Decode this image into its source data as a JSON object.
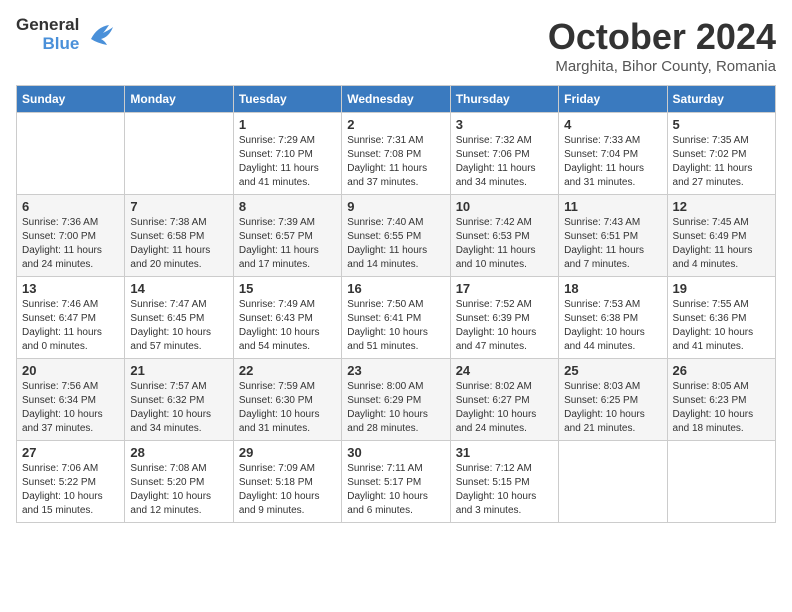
{
  "header": {
    "logo_general": "General",
    "logo_blue": "Blue",
    "month": "October 2024",
    "location": "Marghita, Bihor County, Romania"
  },
  "weekdays": [
    "Sunday",
    "Monday",
    "Tuesday",
    "Wednesday",
    "Thursday",
    "Friday",
    "Saturday"
  ],
  "weeks": [
    [
      {
        "day": "",
        "info": ""
      },
      {
        "day": "",
        "info": ""
      },
      {
        "day": "1",
        "info": "Sunrise: 7:29 AM\nSunset: 7:10 PM\nDaylight: 11 hours and 41 minutes."
      },
      {
        "day": "2",
        "info": "Sunrise: 7:31 AM\nSunset: 7:08 PM\nDaylight: 11 hours and 37 minutes."
      },
      {
        "day": "3",
        "info": "Sunrise: 7:32 AM\nSunset: 7:06 PM\nDaylight: 11 hours and 34 minutes."
      },
      {
        "day": "4",
        "info": "Sunrise: 7:33 AM\nSunset: 7:04 PM\nDaylight: 11 hours and 31 minutes."
      },
      {
        "day": "5",
        "info": "Sunrise: 7:35 AM\nSunset: 7:02 PM\nDaylight: 11 hours and 27 minutes."
      }
    ],
    [
      {
        "day": "6",
        "info": "Sunrise: 7:36 AM\nSunset: 7:00 PM\nDaylight: 11 hours and 24 minutes."
      },
      {
        "day": "7",
        "info": "Sunrise: 7:38 AM\nSunset: 6:58 PM\nDaylight: 11 hours and 20 minutes."
      },
      {
        "day": "8",
        "info": "Sunrise: 7:39 AM\nSunset: 6:57 PM\nDaylight: 11 hours and 17 minutes."
      },
      {
        "day": "9",
        "info": "Sunrise: 7:40 AM\nSunset: 6:55 PM\nDaylight: 11 hours and 14 minutes."
      },
      {
        "day": "10",
        "info": "Sunrise: 7:42 AM\nSunset: 6:53 PM\nDaylight: 11 hours and 10 minutes."
      },
      {
        "day": "11",
        "info": "Sunrise: 7:43 AM\nSunset: 6:51 PM\nDaylight: 11 hours and 7 minutes."
      },
      {
        "day": "12",
        "info": "Sunrise: 7:45 AM\nSunset: 6:49 PM\nDaylight: 11 hours and 4 minutes."
      }
    ],
    [
      {
        "day": "13",
        "info": "Sunrise: 7:46 AM\nSunset: 6:47 PM\nDaylight: 11 hours and 0 minutes."
      },
      {
        "day": "14",
        "info": "Sunrise: 7:47 AM\nSunset: 6:45 PM\nDaylight: 10 hours and 57 minutes."
      },
      {
        "day": "15",
        "info": "Sunrise: 7:49 AM\nSunset: 6:43 PM\nDaylight: 10 hours and 54 minutes."
      },
      {
        "day": "16",
        "info": "Sunrise: 7:50 AM\nSunset: 6:41 PM\nDaylight: 10 hours and 51 minutes."
      },
      {
        "day": "17",
        "info": "Sunrise: 7:52 AM\nSunset: 6:39 PM\nDaylight: 10 hours and 47 minutes."
      },
      {
        "day": "18",
        "info": "Sunrise: 7:53 AM\nSunset: 6:38 PM\nDaylight: 10 hours and 44 minutes."
      },
      {
        "day": "19",
        "info": "Sunrise: 7:55 AM\nSunset: 6:36 PM\nDaylight: 10 hours and 41 minutes."
      }
    ],
    [
      {
        "day": "20",
        "info": "Sunrise: 7:56 AM\nSunset: 6:34 PM\nDaylight: 10 hours and 37 minutes."
      },
      {
        "day": "21",
        "info": "Sunrise: 7:57 AM\nSunset: 6:32 PM\nDaylight: 10 hours and 34 minutes."
      },
      {
        "day": "22",
        "info": "Sunrise: 7:59 AM\nSunset: 6:30 PM\nDaylight: 10 hours and 31 minutes."
      },
      {
        "day": "23",
        "info": "Sunrise: 8:00 AM\nSunset: 6:29 PM\nDaylight: 10 hours and 28 minutes."
      },
      {
        "day": "24",
        "info": "Sunrise: 8:02 AM\nSunset: 6:27 PM\nDaylight: 10 hours and 24 minutes."
      },
      {
        "day": "25",
        "info": "Sunrise: 8:03 AM\nSunset: 6:25 PM\nDaylight: 10 hours and 21 minutes."
      },
      {
        "day": "26",
        "info": "Sunrise: 8:05 AM\nSunset: 6:23 PM\nDaylight: 10 hours and 18 minutes."
      }
    ],
    [
      {
        "day": "27",
        "info": "Sunrise: 7:06 AM\nSunset: 5:22 PM\nDaylight: 10 hours and 15 minutes."
      },
      {
        "day": "28",
        "info": "Sunrise: 7:08 AM\nSunset: 5:20 PM\nDaylight: 10 hours and 12 minutes."
      },
      {
        "day": "29",
        "info": "Sunrise: 7:09 AM\nSunset: 5:18 PM\nDaylight: 10 hours and 9 minutes."
      },
      {
        "day": "30",
        "info": "Sunrise: 7:11 AM\nSunset: 5:17 PM\nDaylight: 10 hours and 6 minutes."
      },
      {
        "day": "31",
        "info": "Sunrise: 7:12 AM\nSunset: 5:15 PM\nDaylight: 10 hours and 3 minutes."
      },
      {
        "day": "",
        "info": ""
      },
      {
        "day": "",
        "info": ""
      }
    ]
  ]
}
